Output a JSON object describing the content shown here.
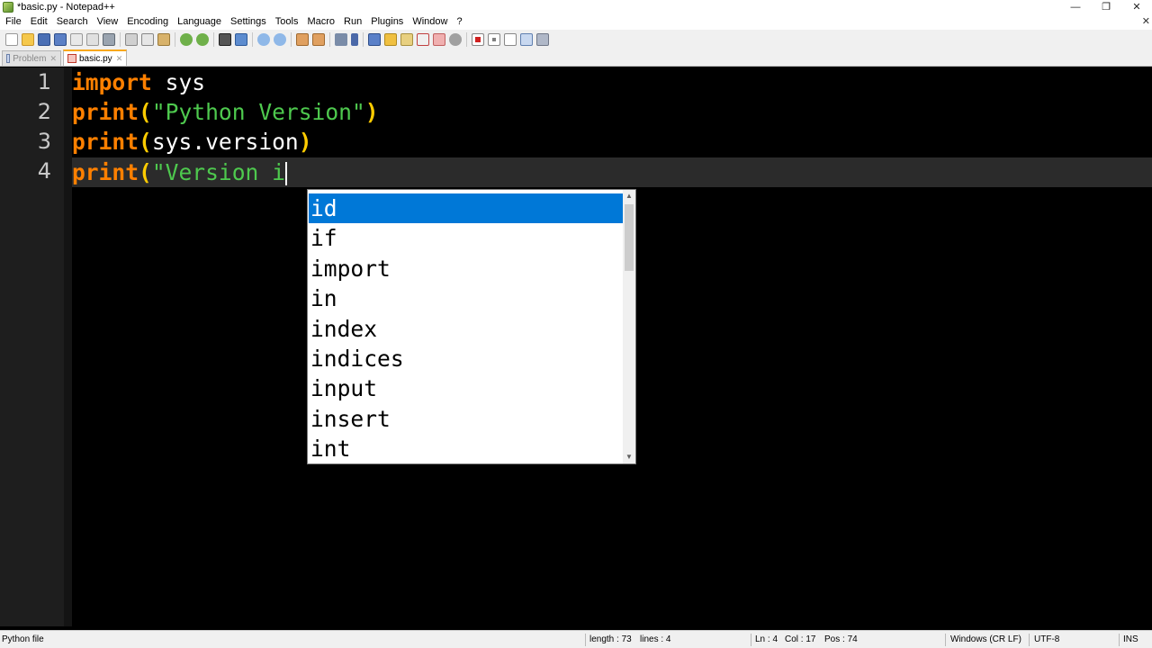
{
  "window": {
    "title": "*basic.py - Notepad++",
    "controls": [
      "—",
      "❐",
      "✕"
    ]
  },
  "menu": [
    "File",
    "Edit",
    "Search",
    "View",
    "Encoding",
    "Language",
    "Settings",
    "Tools",
    "Macro",
    "Run",
    "Plugins",
    "Window",
    "?"
  ],
  "menu_close": "✕",
  "tabs": [
    {
      "label": "Problem",
      "active": false,
      "close": "✕"
    },
    {
      "label": "basic.py",
      "active": true,
      "close": "✕"
    }
  ],
  "editor": {
    "line_numbers": [
      "1",
      "2",
      "3",
      "4"
    ],
    "lines": [
      {
        "kw": "import",
        "rest": " sys"
      },
      {
        "kw": "print",
        "open": "(",
        "str": "\"Python Version\"",
        "close": ")"
      },
      {
        "kw": "print",
        "open": "(",
        "mid": "sys.version",
        "close": ")"
      },
      {
        "kw": "print",
        "open": "(",
        "str": "\"Version i"
      }
    ]
  },
  "autocomplete": {
    "items": [
      "id",
      "if",
      "import",
      "in",
      "index",
      "indices",
      "input",
      "insert",
      "int"
    ],
    "selected_index": 0,
    "scroll_up": "▲",
    "scroll_down": "▼"
  },
  "status": {
    "file_type": "Python file",
    "length": "length : 73",
    "lines": "lines : 4",
    "ln": "Ln : 4",
    "col": "Col : 17",
    "pos": "Pos : 74",
    "eol": "Windows (CR LF)",
    "encoding": "UTF-8",
    "mode": "INS"
  },
  "colors": {
    "keyword": "#ff8000",
    "string": "#4ec94e",
    "operator": "#ffcc00",
    "selection": "#0078d7",
    "tab_accent": "#f8a81c"
  }
}
